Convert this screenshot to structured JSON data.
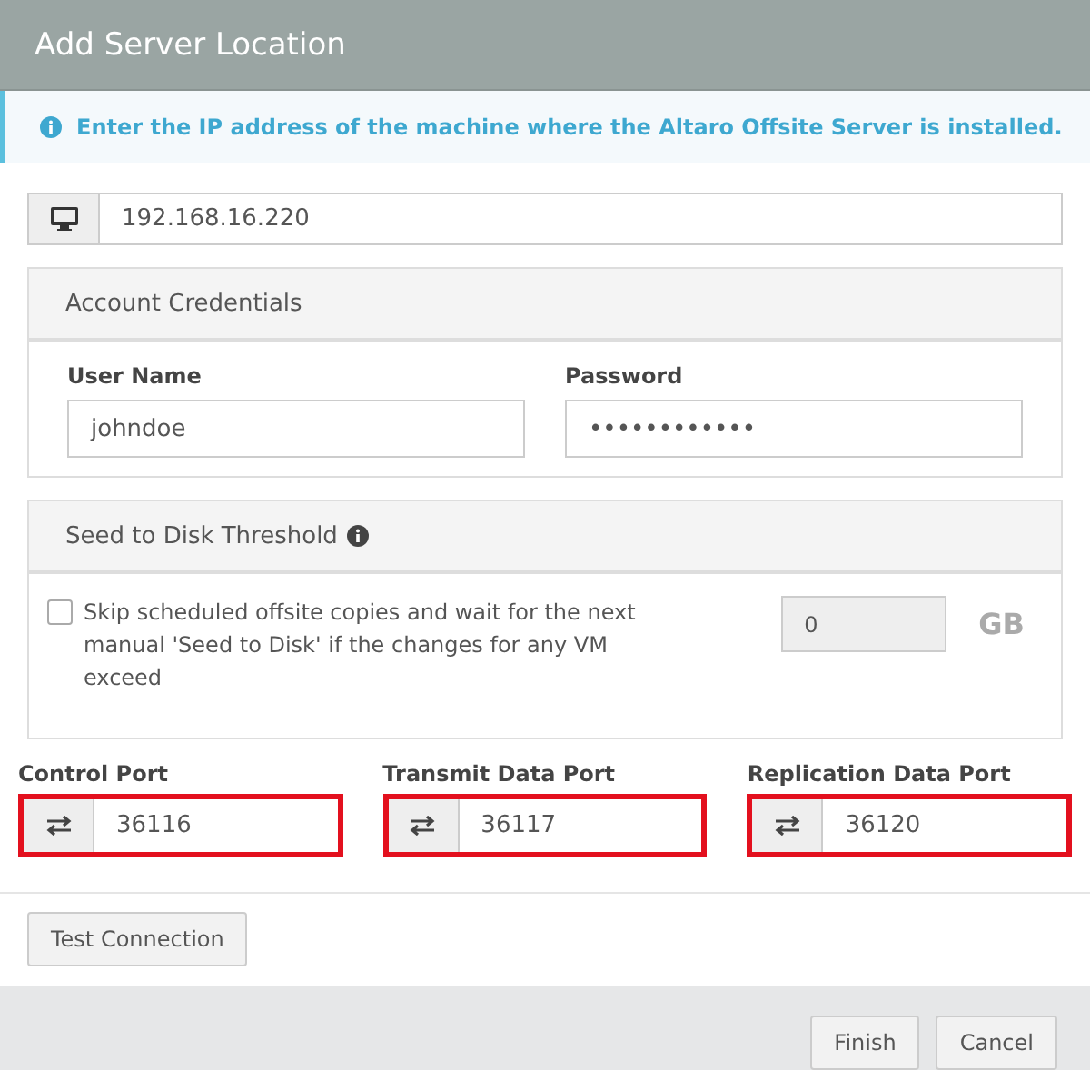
{
  "window": {
    "title": "Add Server Location"
  },
  "info": {
    "text": "Enter the IP address of the machine where the Altaro Offsite Server is installed."
  },
  "address": {
    "value": "192.168.16.220"
  },
  "credentials": {
    "title": "Account Credentials",
    "fields": [
      {
        "label": "User Name",
        "value": "johndoe"
      },
      {
        "label": "Password",
        "value": "••••••••••••"
      }
    ]
  },
  "seed": {
    "title": "Seed to Disk Threshold",
    "checkbox": {
      "label": "Skip scheduled offsite copies and wait for the next manual 'Seed to Disk' if the changes for any VM exceed",
      "checked": false
    },
    "threshold": {
      "value": "0",
      "disabled": true
    },
    "unit": "GB"
  },
  "ports": [
    {
      "label": "Control Port",
      "value": "36116",
      "highlighted": true
    },
    {
      "label": "Transmit Data Port",
      "value": "36117",
      "highlighted": true
    },
    {
      "label": "Replication Data Port",
      "value": "36120",
      "highlighted": true
    }
  ],
  "test_button": "Test Connection",
  "buttons": [
    "Finish",
    "Cancel"
  ]
}
